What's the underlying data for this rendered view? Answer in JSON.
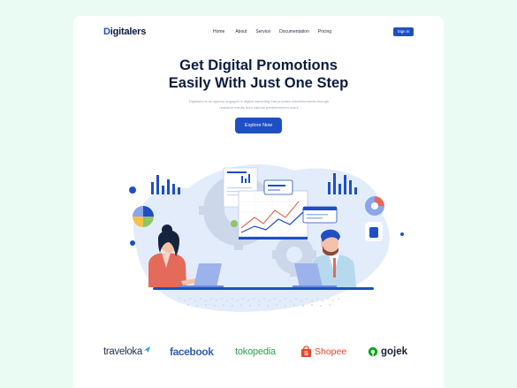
{
  "brand": {
    "prefix": "D",
    "rest": "igitalers"
  },
  "nav": {
    "items": [
      {
        "label": "Home"
      },
      {
        "label": "About"
      },
      {
        "label": "Service"
      },
      {
        "label": "Documentation"
      },
      {
        "label": "Pricing"
      }
    ],
    "signin_label": "Sign in"
  },
  "hero": {
    "title_line1": "Get Digital Promotions",
    "title_line2": "Easily With Just One Step",
    "subtitle": "Digitalers is an agency engaged in digital marketing that provides advertisements through research results from various predetermined users",
    "cta_label": "Explore Now"
  },
  "partners": [
    {
      "name": "traveloka"
    },
    {
      "name": "facebook"
    },
    {
      "name": "tokopedia"
    },
    {
      "name": "Shopee"
    },
    {
      "name": "gojek"
    }
  ],
  "colors": {
    "page_bg": "#eafbf4",
    "primary": "#1e4fc4",
    "heading": "#0b1c3f",
    "muted": "#9aa2b4"
  }
}
